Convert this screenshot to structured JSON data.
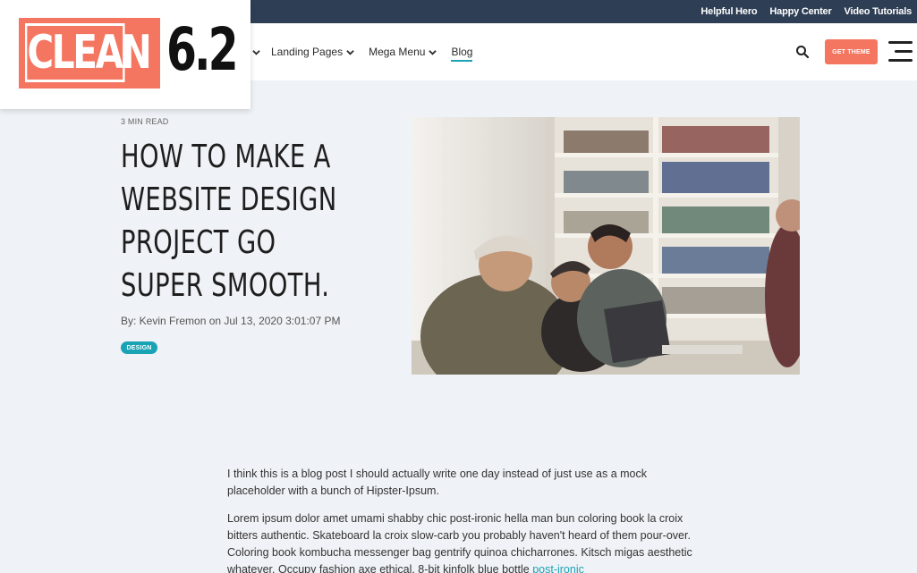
{
  "utility_nav": {
    "links": [
      "Helpful Hero",
      "Happy Center",
      "Video Tutorials"
    ]
  },
  "logo": {
    "word": "CLEAN",
    "version": "6.2"
  },
  "main_nav": {
    "items": [
      {
        "label": "Landing Pages",
        "has_dropdown": true
      },
      {
        "label": "Mega Menu",
        "has_dropdown": true
      },
      {
        "label": "Blog",
        "has_dropdown": false,
        "active": true
      }
    ],
    "cta_label": "GET THEME",
    "search_icon": "search-icon",
    "menu_icon": "hamburger-menu-icon"
  },
  "post": {
    "read_time": "3 MIN READ",
    "title_lines": [
      "HOW TO MAKE A",
      "WEBSITE DESIGN",
      "PROJECT GO",
      "SUPER SMOOTH."
    ],
    "byline": "By: Kevin Fremon on Jul 13, 2020 3:01:07 PM",
    "tag": "DESIGN",
    "paragraph_1": "I think this is a blog post I should actually write one day instead of just use as a mock placeholder with a bunch of Hipster-Ipsum.",
    "paragraph_2": "Lorem ipsum dolor amet umami shabby chic post-ironic hella man bun coloring book la croix bitters authentic. Skateboard la croix slow-carb you probably haven't heard of them pour-over. Coloring book kombucha messenger bag gentrify quinoa chicharrones. Kitsch migas aesthetic whatever. Occupy fashion axe ethical, 8-bit kinfolk blue bottle",
    "paragraph_2_link": "post-ironic"
  },
  "colors": {
    "accent": "#f47560",
    "teal": "#1aa3b4",
    "utility_bar": "#2e3e54",
    "page_bg": "#eff2f6"
  }
}
